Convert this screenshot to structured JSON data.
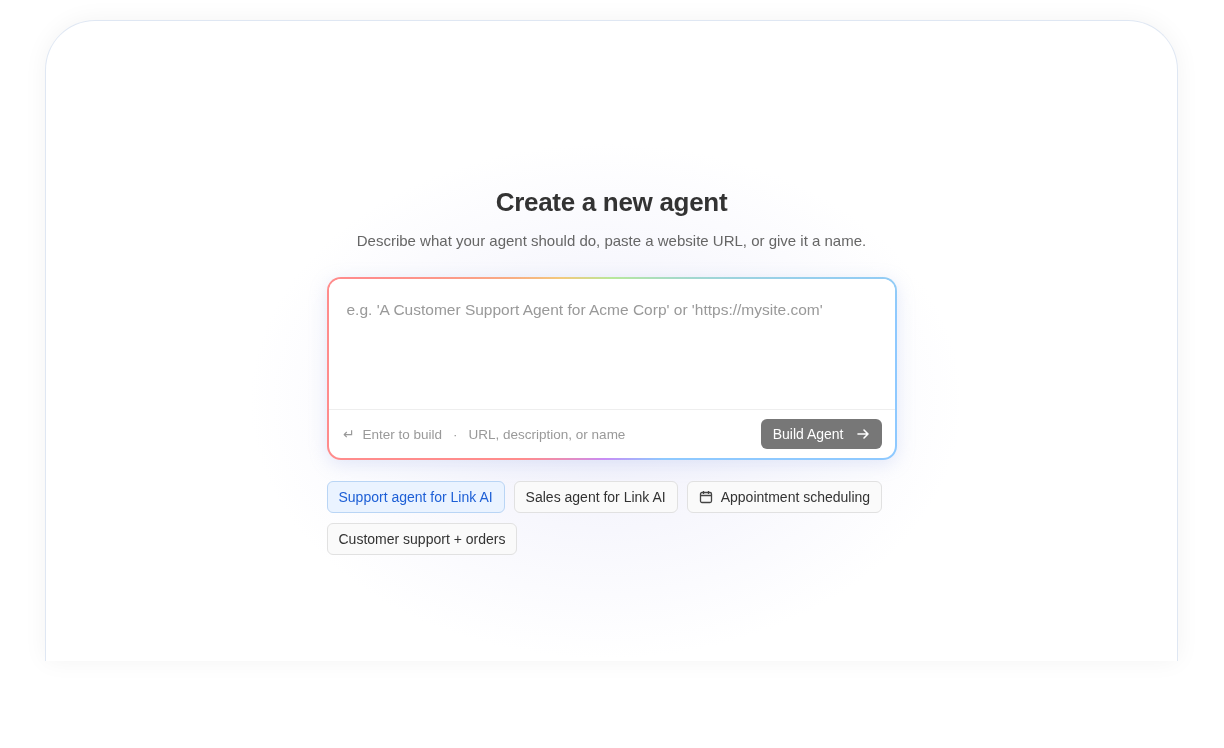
{
  "title": "Create a new agent",
  "subtitle": "Describe what your agent should do, paste a website URL, or give it a name.",
  "prompt": {
    "placeholder": "e.g. 'A Customer Support Agent for Acme Corp' or 'https://mysite.com'",
    "enter_glyph": "↵",
    "hint": "Enter to build",
    "separator": "·",
    "hint_2": "URL, description, or name",
    "button": "Build Agent"
  },
  "suggestions": [
    {
      "label": "Support agent for Link AI",
      "selected": true,
      "kind": "plain"
    },
    {
      "label": "Sales agent for Link AI",
      "selected": false,
      "kind": "plain"
    },
    {
      "label": "Appointment scheduling",
      "selected": false,
      "kind": "scheduling"
    },
    {
      "label": "Customer support + orders",
      "selected": false,
      "kind": "plain"
    }
  ]
}
